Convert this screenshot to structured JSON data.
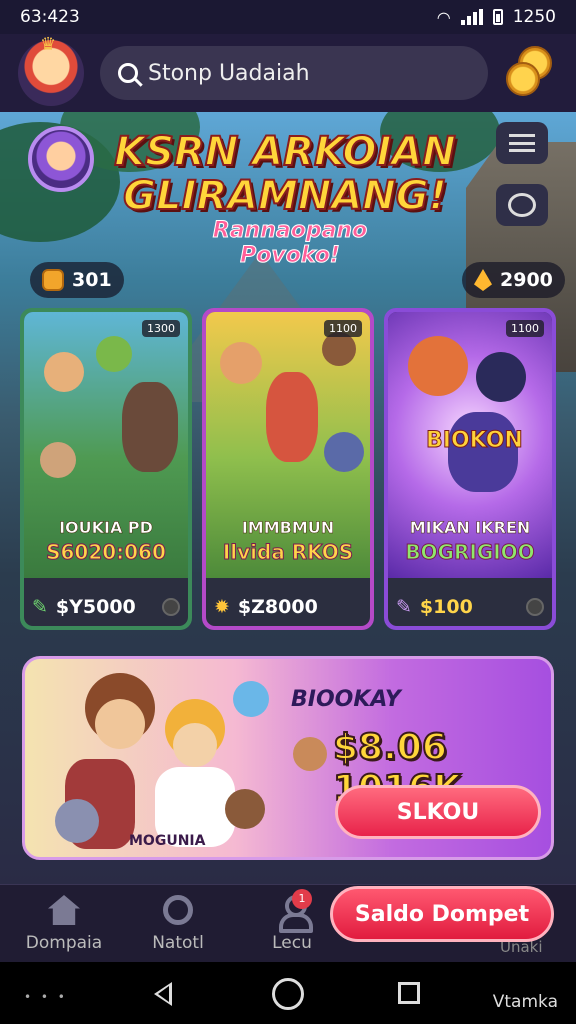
{
  "status_bar": {
    "time": "63:423",
    "clock_right": "1250"
  },
  "header": {
    "search_placeholder": "Stonp Uadaiah"
  },
  "hero": {
    "title_line1": "KSRN ARKOIAN",
    "title_line2": "GLIRAMNANG!",
    "subtitle": "Rannaopano Povoko!",
    "left_counter": "301",
    "right_counter": "2900"
  },
  "cards": [
    {
      "tag": "1300",
      "name": "IOUKIA PD",
      "prize": "S6020:060",
      "price": "$Y5000",
      "accent": "#3d8f56"
    },
    {
      "tag": "1100",
      "name": "IMMBMUN",
      "prize": "Ilvida RKOS",
      "price": "$Z8000",
      "accent": "#b04ac9"
    },
    {
      "tag": "1100",
      "name": "MIKAN IKREN",
      "prize": "BOGRIGIOO",
      "price": "$100",
      "accent": "#8a4cd8"
    }
  ],
  "card_brand": "BIOKON",
  "promo": {
    "brand": "BIOOKAY",
    "amount": "$8.06 1016K",
    "button": "SLKOU",
    "caption": "MOGUNIA"
  },
  "bottom_nav": {
    "items": [
      {
        "label": "Dompaia"
      },
      {
        "label": "Natotl"
      },
      {
        "label": "Lecu",
        "badge": "1"
      }
    ],
    "wallet_button": "Saldo Dompet",
    "hidden_label": "Unaki"
  },
  "system_nav": {
    "label": "Vtamka"
  }
}
